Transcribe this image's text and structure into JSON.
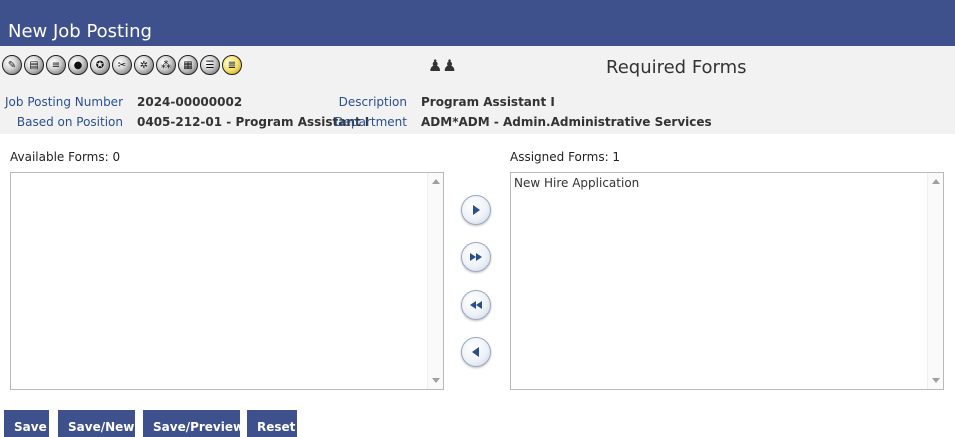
{
  "window": {
    "title": "New Job Posting"
  },
  "toolbar": {
    "icons": [
      "pen-icon",
      "book-icon",
      "notes-icon",
      "globe-icon",
      "ribbon-icon",
      "wrench-icon",
      "gear-icon",
      "cluster-icon",
      "table-icon",
      "document-icon",
      "checklist-icon"
    ],
    "people_icon": "people-icon",
    "section_title": "Required Forms"
  },
  "posting": {
    "number_label": "Job Posting Number",
    "number_value": "2024-00000002",
    "position_label": "Based on Position",
    "position_value": "0405-212-01 - Program Assistant I",
    "description_label": "Description",
    "description_value": "Program Assistant I",
    "department_label": "Department",
    "department_value": "ADM*ADM - Admin.Administrative Services"
  },
  "available": {
    "label": "Available Forms: 0",
    "items": []
  },
  "assigned": {
    "label": "Assigned Forms: 1",
    "items": [
      "New Hire Application"
    ]
  },
  "move_buttons": [
    "move-right-icon",
    "move-all-right-icon",
    "move-all-left-icon",
    "move-left-icon"
  ],
  "actions": {
    "save": "Save",
    "save_new": "Save/New",
    "save_preview": "Save/Preview",
    "reset": "Reset"
  },
  "colors": {
    "header_bg": "#3f518c",
    "toolbar_bg": "#f2f2f2",
    "label_blue": "#2a4f8f"
  }
}
